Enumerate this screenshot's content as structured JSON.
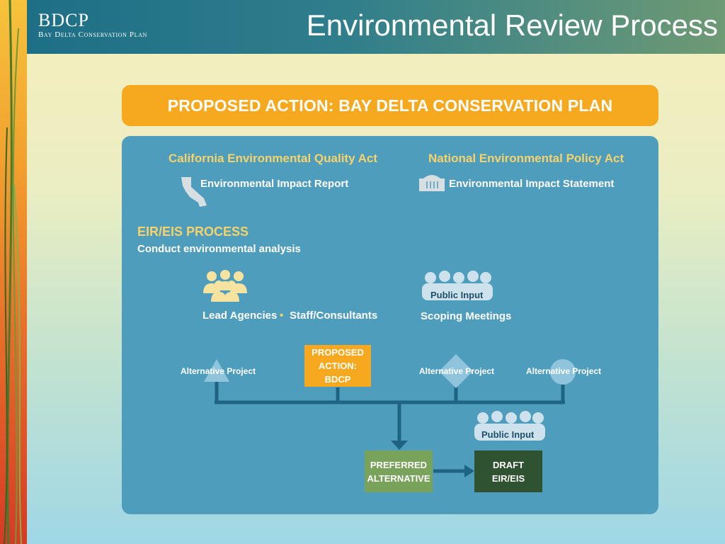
{
  "header": {
    "logo_title": "BDCP",
    "logo_subtitle": "Bay Delta Conservation Plan",
    "slide_title": "Environmental Review Process"
  },
  "proposed_action_banner": "PROPOSED ACTION: BAY DELTA CONSERVATION PLAN",
  "ceqa": {
    "heading": "California Environmental Quality Act",
    "document": "Environmental Impact Report",
    "icon": "california-state-icon"
  },
  "nepa": {
    "heading": "National Environmental Policy Act",
    "document": "Environmental Impact Statement",
    "icon": "capitol-building-icon"
  },
  "process": {
    "heading": "EIR/EIS PROCESS",
    "subheading": "Conduct environmental analysis"
  },
  "groups": {
    "lead_agencies": "Lead Agencies",
    "separator": "•",
    "staff": "Staff/Consultants",
    "public_input_1": "Public Input",
    "scoping": "Scoping Meetings",
    "public_input_2": "Public Input"
  },
  "alternatives": {
    "alt1": "Alternative Project",
    "proposed_line1": "PROPOSED",
    "proposed_line2": "ACTION: BDCP",
    "alt2": "Alternative Project",
    "alt3": "Alternative Project"
  },
  "outcomes": {
    "preferred_line1": "PREFERRED",
    "preferred_line2": "ALTERNATIVE",
    "draft_line1": "DRAFT",
    "draft_line2": "EIR/EIS"
  },
  "colors": {
    "orange": "#f6a81f",
    "panel_blue": "#4f9dbd",
    "yellow_text": "#f6d36a",
    "green_box": "#79a35a",
    "dark_green_box": "#2f5230"
  }
}
